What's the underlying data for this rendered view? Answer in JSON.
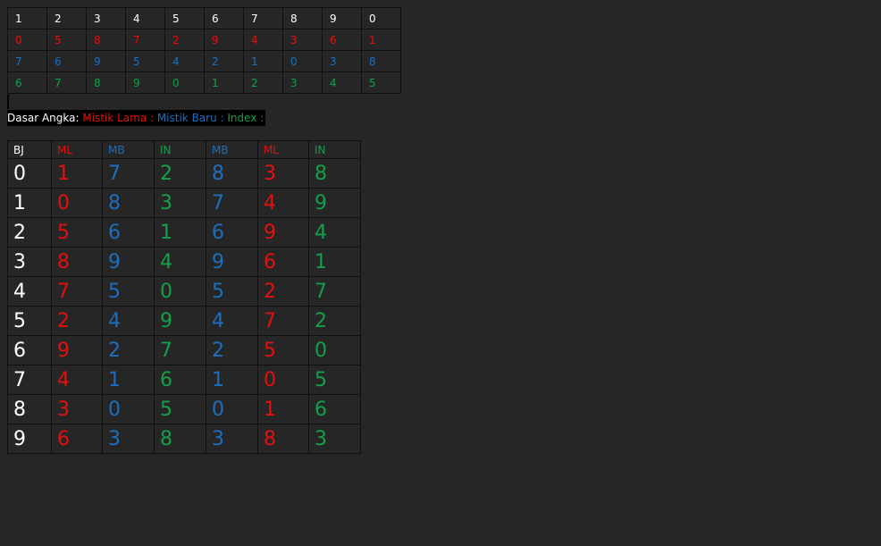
{
  "top_table": {
    "header": [
      "1",
      "2",
      "3",
      "4",
      "5",
      "6",
      "7",
      "8",
      "9",
      "0"
    ],
    "mistik_lama": [
      "0",
      "5",
      "8",
      "7",
      "2",
      "9",
      "4",
      "3",
      "6",
      "1"
    ],
    "mistik_baru": [
      "7",
      "6",
      "9",
      "5",
      "4",
      "2",
      "1",
      "0",
      "3",
      "8"
    ],
    "index": [
      "6",
      "7",
      "8",
      "9",
      "0",
      "1",
      "2",
      "3",
      "4",
      "5"
    ]
  },
  "caption": {
    "prefix": "Dasar Angka:",
    "mistik_lama": " Mistik Lama :",
    "mistik_baru": " Mistik Baru :",
    "index": " Index :"
  },
  "main_table": {
    "headers": [
      "BJ",
      "ML",
      "MB",
      "IN",
      "MB",
      "ML",
      "IN"
    ],
    "rows": [
      [
        "0",
        "1",
        "7",
        "2",
        "8",
        "3",
        "8"
      ],
      [
        "1",
        "0",
        "8",
        "3",
        "7",
        "4",
        "9"
      ],
      [
        "2",
        "5",
        "6",
        "1",
        "6",
        "9",
        "4"
      ],
      [
        "3",
        "8",
        "9",
        "4",
        "9",
        "6",
        "1"
      ],
      [
        "4",
        "7",
        "5",
        "0",
        "5",
        "2",
        "7"
      ],
      [
        "5",
        "2",
        "4",
        "9",
        "4",
        "7",
        "2"
      ],
      [
        "6",
        "9",
        "2",
        "7",
        "2",
        "5",
        "0"
      ],
      [
        "7",
        "4",
        "1",
        "6",
        "1",
        "0",
        "5"
      ],
      [
        "8",
        "3",
        "0",
        "5",
        "0",
        "1",
        "6"
      ],
      [
        "9",
        "6",
        "3",
        "8",
        "3",
        "8",
        "3"
      ]
    ]
  },
  "colors": {
    "red": "#e50f0f",
    "blue": "#1c6fbf",
    "green": "#12a04a",
    "white": "#ffffff",
    "background": "#262626"
  }
}
